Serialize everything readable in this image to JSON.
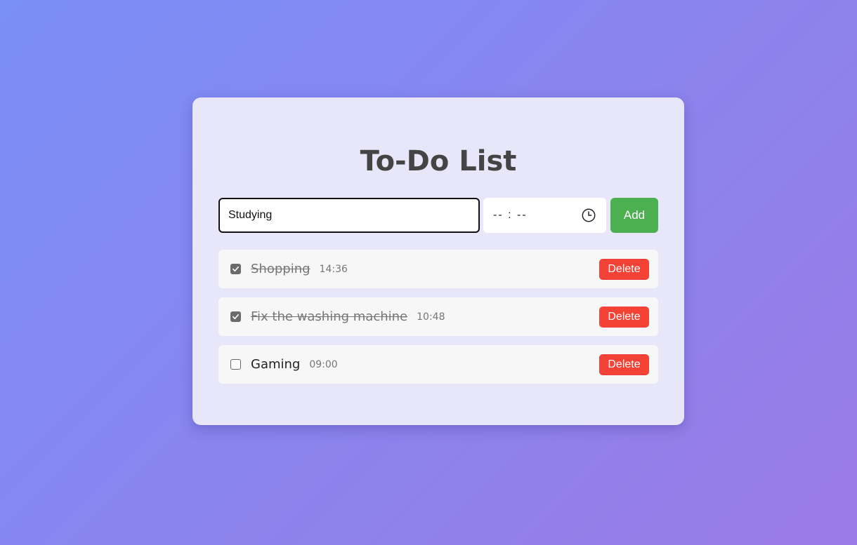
{
  "app": {
    "title": "To-Do List"
  },
  "form": {
    "task_value": "Studying",
    "time_value": "-- : --",
    "time_icon": "clock-icon",
    "add_label": "Add"
  },
  "tasks": [
    {
      "name": "Shopping",
      "time": "14:36",
      "completed": true,
      "delete_label": "Delete"
    },
    {
      "name": "Fix the washing machine",
      "time": "10:48",
      "completed": true,
      "delete_label": "Delete"
    },
    {
      "name": "Gaming",
      "time": "09:00",
      "completed": false,
      "delete_label": "Delete"
    }
  ],
  "colors": {
    "add_button": "#4caf50",
    "delete_button": "#f44336",
    "card_background": "#e8e7fa",
    "title_text": "#444444"
  }
}
